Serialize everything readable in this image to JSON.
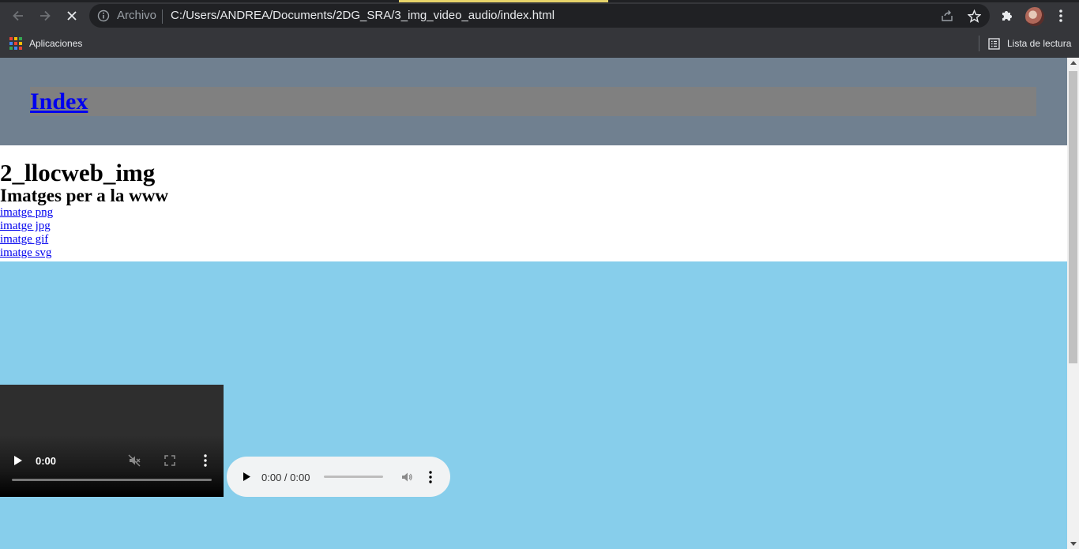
{
  "browser": {
    "scheme_label": "Archivo",
    "url": "C:/Users/ANDREA/Documents/2DG_SRA/3_img_video_audio/index.html",
    "bookmarks": {
      "apps_label": "Aplicaciones",
      "reading_list_label": "Lista de lectura"
    },
    "icons": [
      "back-icon",
      "forward-icon",
      "stop-icon",
      "info-icon",
      "share-icon",
      "star-icon",
      "extensions-icon",
      "avatar",
      "menu-icon",
      "apps-icon",
      "reading-list-icon"
    ]
  },
  "page": {
    "header_link": "Index",
    "title": "2_llocweb_img",
    "subtitle": "Imatges per a la www",
    "links": [
      "imatge png",
      "imatge jpg",
      "imatge gif",
      "imatge svg"
    ],
    "video": {
      "time": "0:00",
      "progress": 0
    },
    "audio": {
      "time": "0:00 / 0:00",
      "progress": 0
    },
    "colors": {
      "header_bg": "#708090",
      "header_bar_bg": "#808080",
      "media_bg": "#87ceeb",
      "link": "#0000ee"
    }
  }
}
